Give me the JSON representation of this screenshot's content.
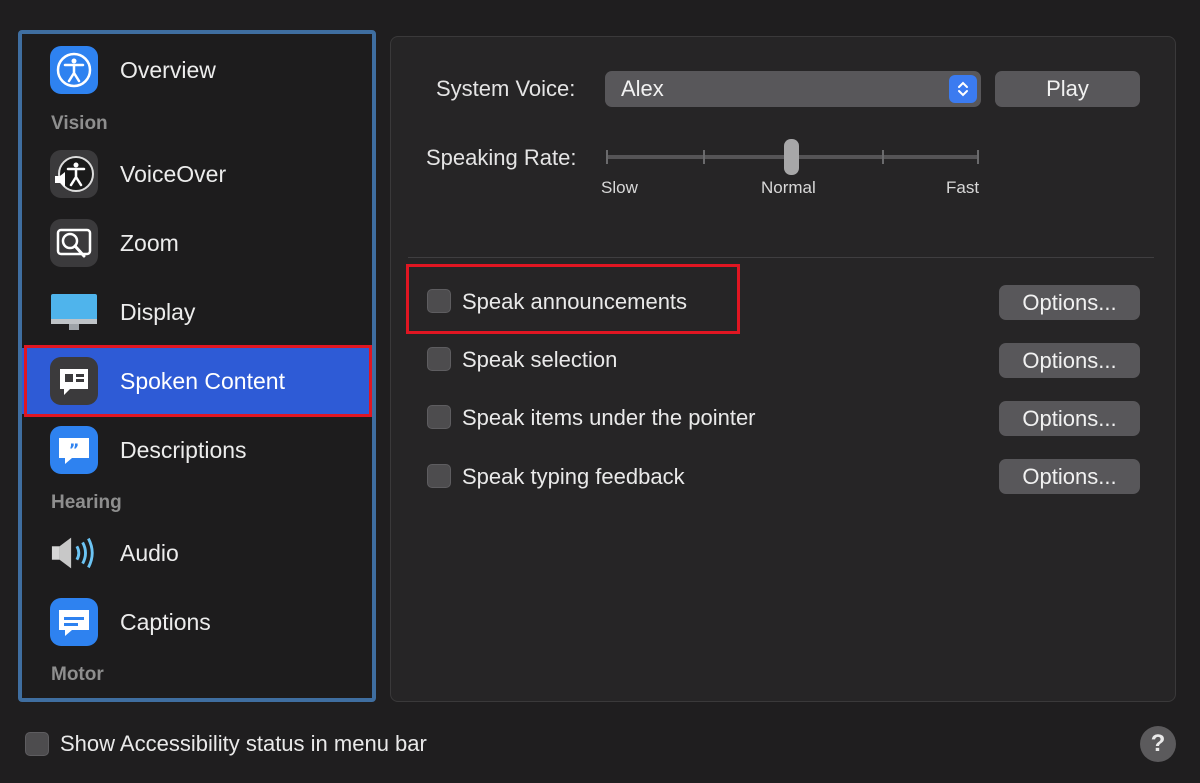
{
  "sidebar": {
    "sections": {
      "vision": "Vision",
      "hearing": "Hearing",
      "motor": "Motor"
    },
    "items": [
      {
        "label": "Overview",
        "icon": "accessibility-icon"
      },
      {
        "label": "VoiceOver",
        "icon": "voiceover-icon"
      },
      {
        "label": "Zoom",
        "icon": "zoom-icon"
      },
      {
        "label": "Display",
        "icon": "display-icon"
      },
      {
        "label": "Spoken Content",
        "icon": "spoken-content-icon",
        "selected": true
      },
      {
        "label": "Descriptions",
        "icon": "quote-bubble-icon"
      },
      {
        "label": "Audio",
        "icon": "speaker-icon"
      },
      {
        "label": "Captions",
        "icon": "captions-icon"
      }
    ]
  },
  "main": {
    "system_voice_label": "System Voice:",
    "system_voice_value": "Alex",
    "play_label": "Play",
    "speaking_rate_label": "Speaking Rate:",
    "rate_ticks": {
      "slow": "Slow",
      "normal": "Normal",
      "fast": "Fast"
    },
    "speaking_rate_value": "Normal",
    "options": [
      {
        "label": "Speak announcements",
        "checked": false,
        "button": "Options..."
      },
      {
        "label": "Speak selection",
        "checked": false,
        "button": "Options..."
      },
      {
        "label": "Speak items under the pointer",
        "checked": false,
        "button": "Options..."
      },
      {
        "label": "Speak typing feedback",
        "checked": false,
        "button": "Options..."
      }
    ]
  },
  "footer": {
    "status_checkbox_label": "Show Accessibility status in menu bar",
    "status_checked": false,
    "help_label": "?"
  },
  "colors": {
    "accent": "#2e5bd6",
    "highlight_outline": "#e01622",
    "sidebar_border": "#3f6ea0"
  }
}
